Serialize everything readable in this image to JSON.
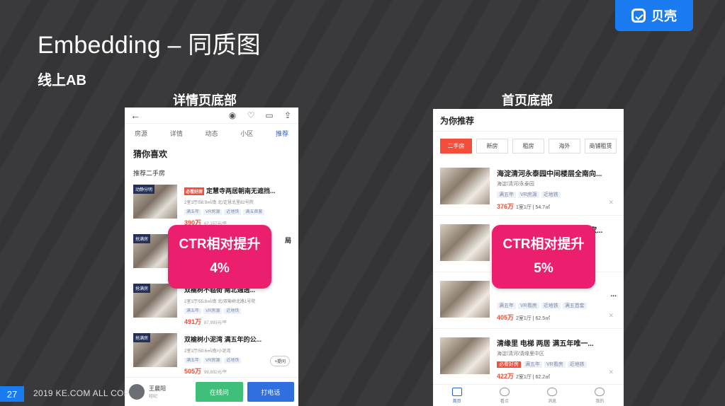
{
  "slide": {
    "title": "Embedding – 同质图",
    "subtitle": "线上AB",
    "brand": "贝壳",
    "page_number": "27",
    "copyright": "2019 KE.COM ALL COP"
  },
  "captions": {
    "left": "详情页底部",
    "right": "首页底部"
  },
  "phone_left": {
    "tabs": [
      "房源",
      "详情",
      "动态",
      "小区",
      "推荐"
    ],
    "heading": "猜你喜欢",
    "section": "推荐二手房",
    "items": [
      {
        "tag": "动静分明",
        "hot": "必看好房",
        "name": "定慧寺两居朝南无遮挡...",
        "meta": "2室1厅/58.9㎡/南 北/定慧北里82号院",
        "chips": [
          "满五年",
          "VR房源",
          "近地铁",
          "满五首套"
        ],
        "price": "390万",
        "unit": "67,157元/平"
      },
      {
        "tag": "抢满房",
        "name": "局",
        "meta": "",
        "chips": [],
        "price": "",
        "unit": ""
      },
      {
        "tag": "抢满房",
        "name": "双榆树不临街 南北通透...",
        "meta": "2室1厅/55.8㎡/南 北/双榆树北路1号院",
        "chips": [
          "满五年",
          "VR房源",
          "近地铁"
        ],
        "price": "491万",
        "unit": "87,993元/平"
      },
      {
        "tag": "抢满房",
        "name": "双榆树小泥湾 满五年的公...",
        "meta": "2室1厅/50.6㎡/南/小泥湾",
        "chips": [
          "满五年",
          "VR房源",
          "近地铁"
        ],
        "price": "505万",
        "unit": "99,802元/平"
      }
    ],
    "ask_label": "+提问",
    "agent_name": "王晨阳",
    "agent_role": "经纪",
    "btn_online": "在线问",
    "btn_call": "打电话"
  },
  "phone_right": {
    "heading": "为你推荐",
    "tabs": [
      "二手房",
      "新房",
      "租房",
      "海外",
      "商铺租赁"
    ],
    "items": [
      {
        "name": "海淀清河永泰园中间楼层全南向...",
        "area": "海淀/清河/永泰园",
        "chips": [
          "满五年",
          "VR房源",
          "近地铁"
        ],
        "hot": false,
        "price": "376万",
        "detail": "1室1厅 | 54.7㎡"
      },
      {
        "name": "海淀清河永泰东里 2居 满五年家...",
        "area": "",
        "chips": [],
        "hot": false,
        "price": "",
        "detail": ""
      },
      {
        "name": "...",
        "area": "",
        "chips": [
          "满五年",
          "VR看房",
          "近地铁",
          "满五首套"
        ],
        "hot": false,
        "price": "405万",
        "detail": "2室1厅 | 62.5㎡"
      },
      {
        "name": "清缘里 电梯 两居 满五年唯一...",
        "area": "海淀/清河/清缘里中区",
        "chips": [
          "必看好房",
          "满五年",
          "VR看房",
          "近地铁"
        ],
        "hot": true,
        "price": "422万",
        "detail": "2室1厅 | 62.2㎡"
      }
    ],
    "nav": [
      "首页",
      "看点",
      "消息",
      "我的"
    ]
  },
  "badges": {
    "left": {
      "line1": "CTR相对提升",
      "line2": "4%"
    },
    "right": {
      "line1": "CTR相对提升",
      "line2": "5%"
    }
  },
  "colors": {
    "background": "#3a3a3c",
    "brand_blue": "#1b7cf1",
    "badge_pink": "#ec1e6e",
    "price_red": "#e8503a"
  }
}
